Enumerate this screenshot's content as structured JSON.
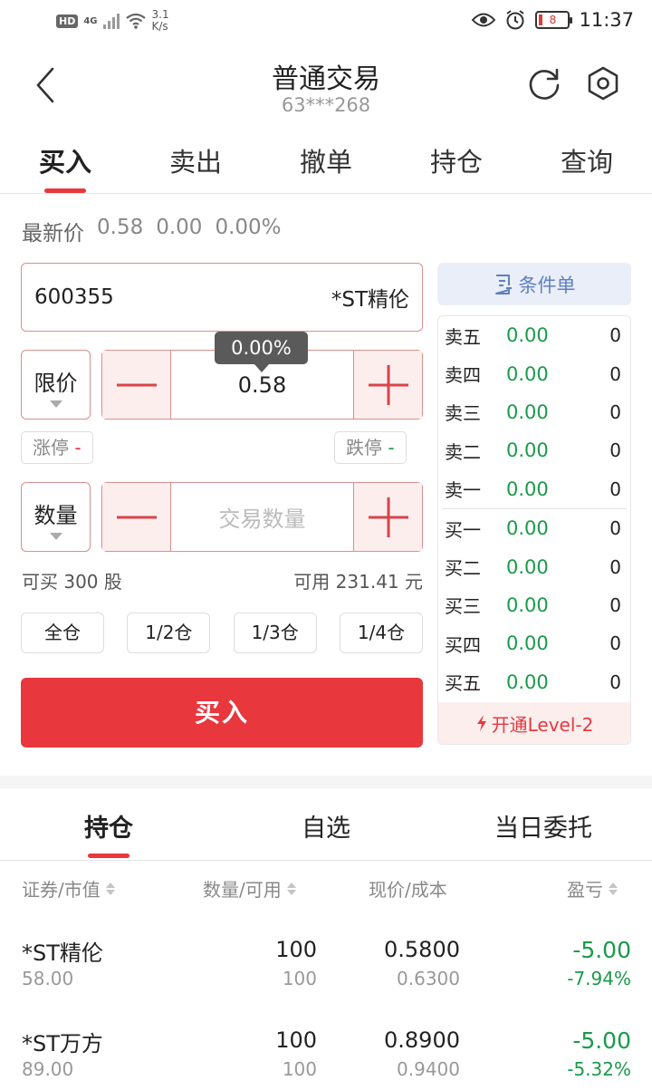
{
  "status": {
    "hd": "HD",
    "network": "4G",
    "speed_value": "3.1",
    "speed_unit": "K/s",
    "battery": "8",
    "time": "11:37"
  },
  "header": {
    "title": "普通交易",
    "account": "63***268"
  },
  "tabs": [
    "买入",
    "卖出",
    "撤单",
    "持仓",
    "查询"
  ],
  "latest": {
    "label": "最新价",
    "price": "0.58",
    "change": "0.00",
    "percent": "0.00%"
  },
  "stock": {
    "code": "600355",
    "name": "*ST精伦"
  },
  "price_type": "限价",
  "price_value": "0.58",
  "price_tip": "0.00%",
  "limit_up": {
    "label": "涨停",
    "value": "-"
  },
  "limit_down": {
    "label": "跌停",
    "value": "-"
  },
  "qty_type": "数量",
  "qty_placeholder": "交易数量",
  "can_buy": {
    "label": "可买",
    "value": "300",
    "unit": "股"
  },
  "available": {
    "label": "可用",
    "value": "231.41",
    "unit": "元"
  },
  "position_buttons": [
    "全仓",
    "1/2仓",
    "1/3仓",
    "1/4仓"
  ],
  "buy_button": "买入",
  "condition_button": "条件单",
  "order_book": {
    "sell": [
      {
        "name": "卖五",
        "price": "0.00",
        "vol": "0"
      },
      {
        "name": "卖四",
        "price": "0.00",
        "vol": "0"
      },
      {
        "name": "卖三",
        "price": "0.00",
        "vol": "0"
      },
      {
        "name": "卖二",
        "price": "0.00",
        "vol": "0"
      },
      {
        "name": "卖一",
        "price": "0.00",
        "vol": "0"
      }
    ],
    "buy": [
      {
        "name": "买一",
        "price": "0.00",
        "vol": "0"
      },
      {
        "name": "买二",
        "price": "0.00",
        "vol": "0"
      },
      {
        "name": "买三",
        "price": "0.00",
        "vol": "0"
      },
      {
        "name": "买四",
        "price": "0.00",
        "vol": "0"
      },
      {
        "name": "买五",
        "price": "0.00",
        "vol": "0"
      }
    ],
    "level2": "开通Level-2"
  },
  "bottom_tabs": [
    "持仓",
    "自选",
    "当日委托"
  ],
  "holdings_header": [
    "证券/市值",
    "数量/可用",
    "现价/成本",
    "盈亏"
  ],
  "holdings": [
    {
      "name": "*ST精伦",
      "value": "58.00",
      "qty": "100",
      "avail": "100",
      "price": "0.5800",
      "cost": "0.6300",
      "pl": "-5.00",
      "pl_pct": "-7.94%"
    },
    {
      "name": "*ST万方",
      "value": "89.00",
      "qty": "100",
      "avail": "100",
      "price": "0.8900",
      "cost": "0.9400",
      "pl": "-5.00",
      "pl_pct": "-5.32%"
    }
  ],
  "colors": {
    "accent_red": "#e8383d",
    "down_green": "#1a9a4a",
    "condition_blue": "#5f7fbf"
  }
}
